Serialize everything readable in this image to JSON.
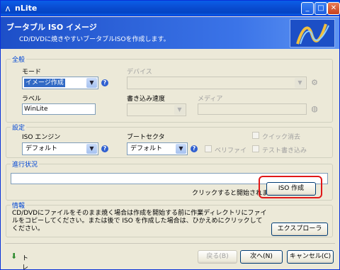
{
  "window": {
    "title": "nLite",
    "app_icon": "nlite-icon",
    "controls": [
      "_",
      "□",
      "✕"
    ]
  },
  "header": {
    "title": "ブータブル ISO イメージ",
    "description": "CD/DVDに焼きやすいブータブルISOを作成します。"
  },
  "general": {
    "legend": "全般",
    "mode_label": "モード",
    "mode_value": "イメージ作成",
    "device_label": "デバイス",
    "device_value": "",
    "label_label": "ラベル",
    "label_value": "WinLite",
    "write_speed_label": "書き込み速度",
    "write_speed_value": "",
    "media_label": "メディア",
    "media_value": ""
  },
  "options": {
    "legend": "設定",
    "iso_engine_label": "ISO エンジン",
    "iso_engine_value": "デフォルト",
    "boot_sector_label": "ブートセクタ",
    "boot_sector_value": "デフォルト",
    "quick_erase_label": "クイック消去",
    "verify_label": "ベリファイ",
    "test_write_label": "テスト書き込み"
  },
  "progress": {
    "legend": "進行状況",
    "percent": 0,
    "hint": "クリックすると開始されます→",
    "make_iso_button": "ISO 作成"
  },
  "info": {
    "legend": "情報",
    "text": "CD/DVDにファイルをそのまま焼く場合は作成を開始する前に作業ディレクトリにファイルをコピーしてください。または後で ISO を作成した場合は、ひかえめにクリックしてください。",
    "explorer_button": "エクスプローラ"
  },
  "footer": {
    "tray_label": "トレイ",
    "back_button": "戻る(B)",
    "next_button": "次へ(N)",
    "cancel_button": "キャンセル(C)"
  },
  "colors": {
    "title_bar": "#0a4ed4",
    "header": "#2a5fd6",
    "group_legend": "#0046d5",
    "highlight": "#e01818"
  }
}
